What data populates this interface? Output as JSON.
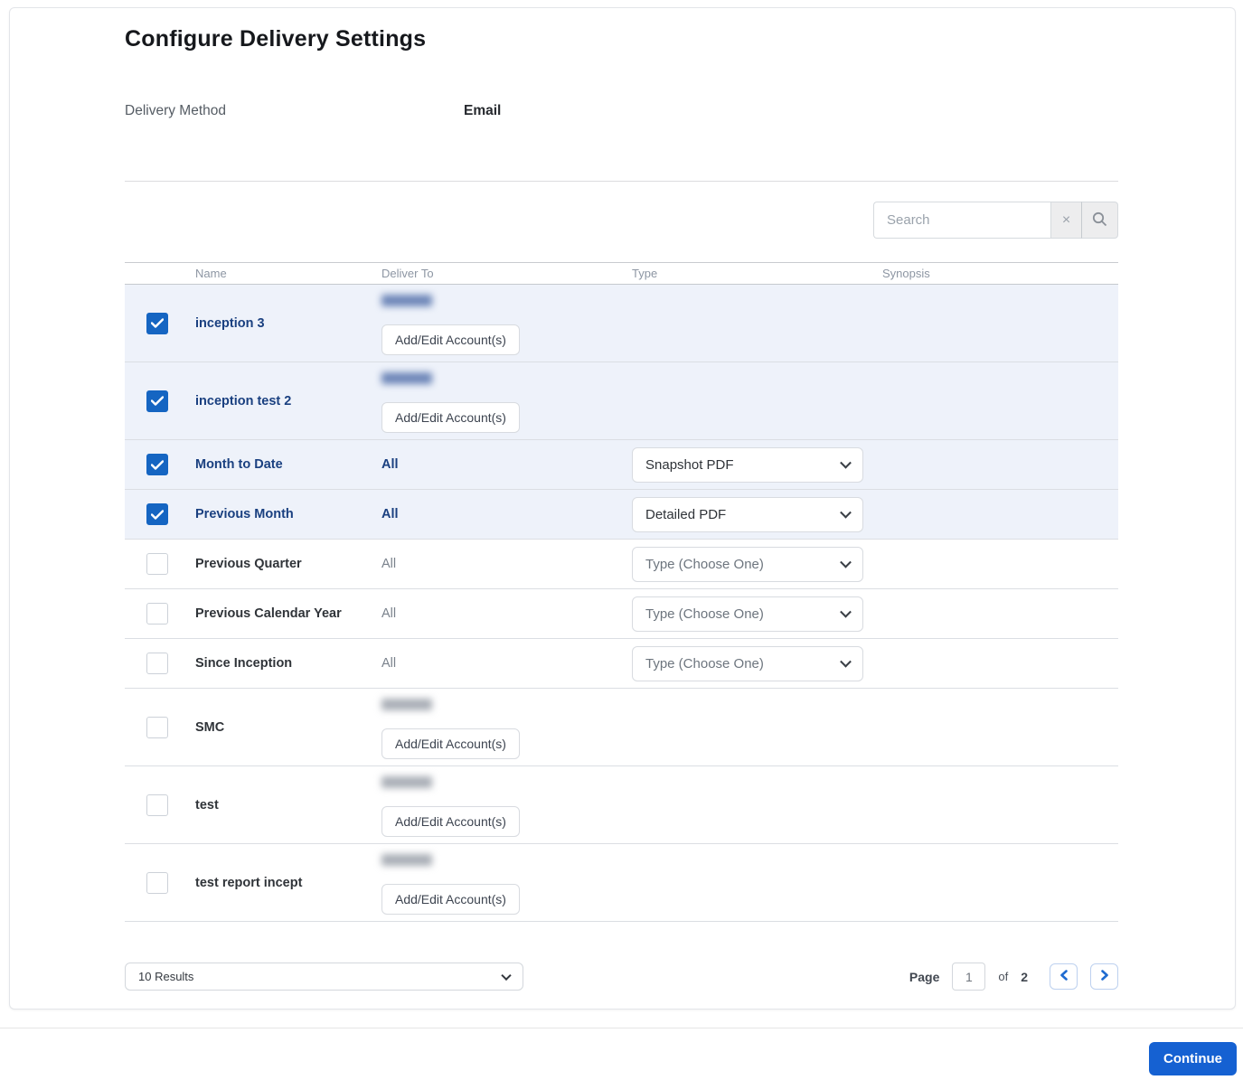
{
  "header": {
    "title": "Configure Delivery Settings"
  },
  "delivery": {
    "label": "Delivery Method",
    "value": "Email"
  },
  "search": {
    "placeholder": "Search",
    "clear_icon": "×"
  },
  "table": {
    "columns": {
      "name": "Name",
      "deliver_to": "Deliver To",
      "type": "Type",
      "synopsis": "Synopsis"
    },
    "add_edit_label": "Add/Edit Account(s)",
    "rows": [
      {
        "name": "inception 3",
        "checked": true,
        "kind": "accounts"
      },
      {
        "name": "inception test 2",
        "checked": true,
        "kind": "accounts"
      },
      {
        "name": "Month to Date",
        "checked": true,
        "kind": "select",
        "deliver_to": "All",
        "type_value": "Snapshot PDF"
      },
      {
        "name": "Previous Month",
        "checked": true,
        "kind": "select",
        "deliver_to": "All",
        "type_value": "Detailed PDF"
      },
      {
        "name": "Previous Quarter",
        "checked": false,
        "kind": "select",
        "deliver_to": "All",
        "type_value": "Type (Choose One)",
        "placeholder": true
      },
      {
        "name": "Previous Calendar Year",
        "checked": false,
        "kind": "select",
        "deliver_to": "All",
        "type_value": "Type (Choose One)",
        "placeholder": true
      },
      {
        "name": "Since Inception",
        "checked": false,
        "kind": "select",
        "deliver_to": "All",
        "type_value": "Type (Choose One)",
        "placeholder": true
      },
      {
        "name": "SMC",
        "checked": false,
        "kind": "accounts"
      },
      {
        "name": "test",
        "checked": false,
        "kind": "accounts"
      },
      {
        "name": "test report incept",
        "checked": false,
        "kind": "accounts"
      }
    ]
  },
  "pagination": {
    "results_per_page": "10 Results",
    "page_label": "Page",
    "current_page": "1",
    "of_label": "of",
    "total_pages": "2"
  },
  "actions": {
    "continue": "Continue"
  },
  "colors": {
    "checkbox_blue": "#1565c2",
    "selected_row_bg": "#eef2fa",
    "selected_text_blue": "#1a4080",
    "continue_blue": "#1561d2",
    "pager_chevron_blue": "#1f6bd0"
  }
}
